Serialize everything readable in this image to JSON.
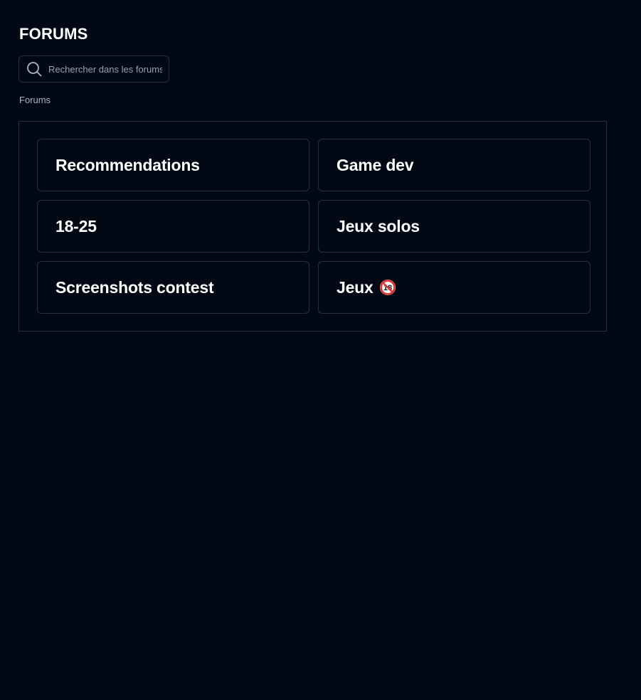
{
  "header": {
    "title": "FORUMS"
  },
  "search": {
    "placeholder": "Rechercher dans les forums",
    "icon": "search-icon"
  },
  "breadcrumb": {
    "current": "Forums"
  },
  "forums": [
    {
      "label": "Recommendations"
    },
    {
      "label": "Game dev"
    },
    {
      "label": "18-25"
    },
    {
      "label": "Jeux solos"
    },
    {
      "label": "Screenshots contest"
    },
    {
      "label": "Jeux",
      "icon": "no-one-under-eighteen-icon"
    }
  ],
  "colors": {
    "background": "#030815",
    "border": "#2a2f3d",
    "text": "#ffffff",
    "muted_text": "#aeb4c2"
  }
}
